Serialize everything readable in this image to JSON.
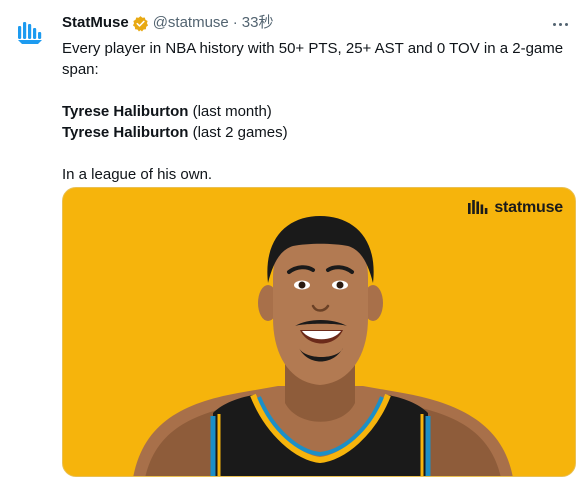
{
  "tweet": {
    "author_name": "StatMuse",
    "handle": "@statmuse",
    "separator": "·",
    "time": "33秒",
    "lines": {
      "line1": "Every player in NBA history with 50+ PTS, 25+ AST and 0 TOV in a 2-game span:",
      "entry1_name": "Tyrese Haliburton",
      "entry1_note": " (last month)",
      "entry2_name": "Tyrese Haliburton",
      "entry2_note": " (last 2 games)",
      "closing": "In a league of his own."
    }
  },
  "media": {
    "logo_text": "statmuse",
    "background_color": "#F6B40C"
  },
  "icons": {
    "avatar": "statmuse-logo-icon",
    "verified": "verified-badge-icon",
    "more": "more-options-icon"
  },
  "colors": {
    "accent_badge": "#E8A913",
    "secondary_text": "#536471"
  }
}
